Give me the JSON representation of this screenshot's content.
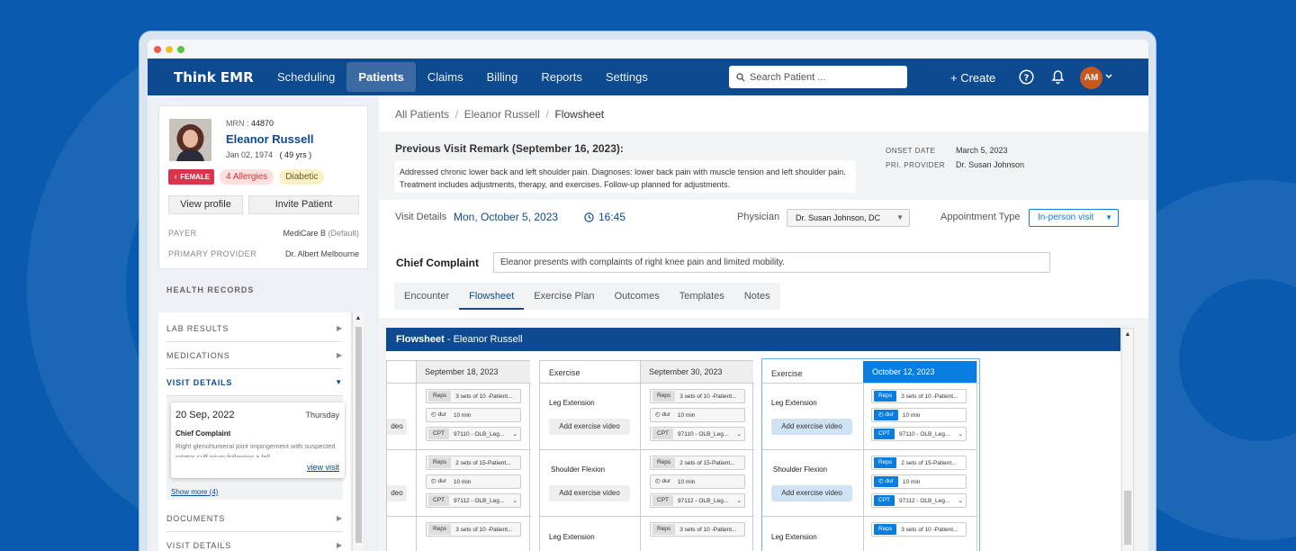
{
  "app": {
    "logo": "Think EMR"
  },
  "nav": {
    "tabs": [
      "Scheduling",
      "Patients",
      "Claims",
      "Billing",
      "Reports",
      "Settings"
    ],
    "search_placeholder": "Search Patient ...",
    "create_label": "+ Create",
    "avatar_initials": "AM"
  },
  "patient": {
    "mrn_label": "MRN :",
    "mrn": "44870",
    "name": "Eleanor Russell",
    "dob": "Jan 02, 1974",
    "age": "( 49 yrs )",
    "gender": "FEMALE",
    "allergies": "4  Allergies",
    "condition": "Diabetic",
    "view_profile": "View profile",
    "invite": "Invite Patient",
    "payer_label": "PAYER",
    "payer": "MediCare B",
    "payer_default": "(Default)",
    "provider_label": "PRIMARY PROVIDER",
    "provider": "Dr. Albert Melbourne"
  },
  "health_records": {
    "title": "HEALTH RECORDS",
    "sections": [
      "LAB RESULTS",
      "MEDICATIONS",
      "VISIT DETAILS",
      "DOCUMENTS",
      "VISIT DETAILS"
    ],
    "visit_card": {
      "date": "20 Sep, 2022",
      "day": "Thursday",
      "heading": "Chief Complaint",
      "text": "Right glenohumeral joint impingement with suspected rotator cuff injury following a fall",
      "link": "view visit"
    },
    "show_more": "Show more (4)"
  },
  "breadcrumb": [
    "All Patients",
    "/",
    "Eleanor Russell",
    "/",
    "Flowsheet"
  ],
  "remark": {
    "title": "Previous Visit Remark (September 16, 2023):",
    "text": "Addressed chronic lower back and left shoulder pain. Diagnoses: lower back pain with muscle tension and left shoulder pain. Treatment includes adjustments, therapy, and exercises. Follow-up planned for adjustments.",
    "onset_label": "ONSET DATE",
    "onset": "March 5, 2023",
    "pri_label": "PRI. PROVIDER",
    "pri": "Dr. Susan Johnson"
  },
  "visit": {
    "label": "Visit Details",
    "date": "Mon, October 5, 2023",
    "time": "16:45",
    "physician_label": "Physician",
    "physician": "Dr. Susan Johnson, DC",
    "appt_label": "Appointment Type",
    "appt": "In-person visit"
  },
  "chief_complaint": {
    "label": "Chief Complaint",
    "value": "Eleanor presents with complaints of right knee pain and limited mobility."
  },
  "tabs": [
    "Encounter",
    "Flowsheet",
    "Exercise Plan",
    "Outcomes",
    "Templates",
    "Notes"
  ],
  "flowsheet": {
    "title_bold": "Flowsheet",
    "title_rest": " - Eleanor Russell",
    "col_exercise": "Exercise",
    "dates": [
      "September 18, 2023",
      "September 30, 2023",
      "October 12, 2023"
    ],
    "video_partial": "deo",
    "exercises": [
      "Leg Extension",
      "Shoulder Flexion",
      "Leg Extension"
    ],
    "add_video": "Add exercise video",
    "tags": {
      "reps": "Reps",
      "dur": "dur",
      "cpt": "CPT"
    },
    "rows": [
      {
        "reps": "3 sets of 10 -Patient...",
        "dur": "10 min",
        "cpt": "97110 - OLB_Leg..."
      },
      {
        "reps": "2 sets of 15-Patient...",
        "dur": "10 min",
        "cpt": "97112 - OLB_Leg..."
      },
      {
        "reps": "3 sets of 10 -Patient..."
      }
    ],
    "accent": "#0a7de0"
  }
}
